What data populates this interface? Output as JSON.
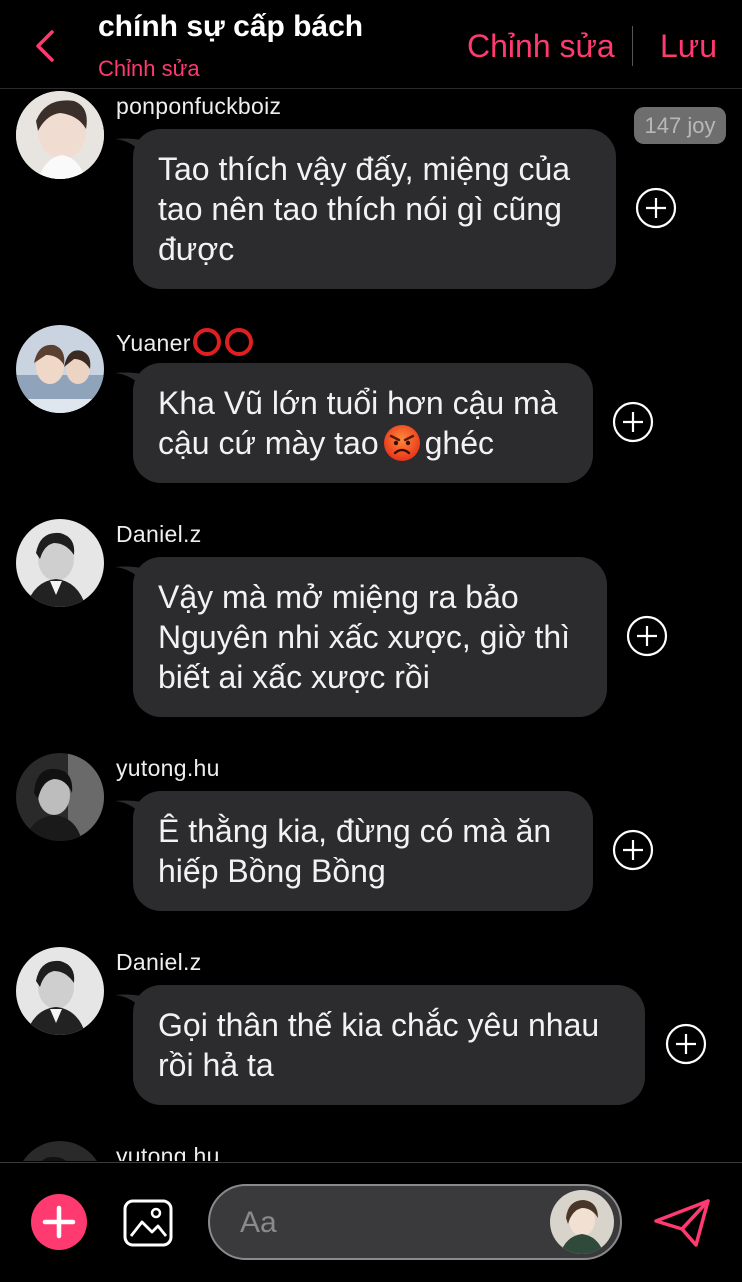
{
  "header": {
    "title": "chính sự cấp bách",
    "subtitle": "Chỉnh sửa",
    "edit_label": "Chỉnh sửa",
    "save_label": "Lưu"
  },
  "messages": [
    {
      "username": "ponponfuckboiz",
      "badge": "147 joy",
      "lines": [
        "Tao thích vậy đấy, miệng của",
        "tao nên tao thích nói gì cũng",
        "được"
      ]
    },
    {
      "username": "Yuaner",
      "username_suffix_icons": [
        "red-ring-icon",
        "red-ring-icon"
      ],
      "lines": [
        "Kha Vũ lớn tuổi hơn cậu mà",
        "cậu cứ mày tao",
        "ghéc"
      ],
      "emoji": "angry-face-icon"
    },
    {
      "username": "Daniel.z",
      "lines": [
        "Vậy mà mở miệng ra bảo",
        "Nguyên nhi xấc xược, giờ thì",
        "biết ai xấc xược rồi"
      ]
    },
    {
      "username": "yutong.hu",
      "lines": [
        "Ê thằng kia, đừng có mà ăn",
        "hiếp Bồng Bồng"
      ]
    },
    {
      "username": "Daniel.z",
      "lines": [
        "Gọi thân thế kia chắc yêu nhau",
        "rồi hả ta"
      ]
    },
    {
      "username": "yutong.hu"
    }
  ],
  "composer": {
    "placeholder": "Aa"
  },
  "colors": {
    "accent": "#ff3a70",
    "bubble": "#2c2c2e",
    "background": "#000000"
  },
  "icons": [
    "chevron-left-icon",
    "plus-icon",
    "image-icon",
    "send-icon",
    "add-reaction-icon"
  ]
}
